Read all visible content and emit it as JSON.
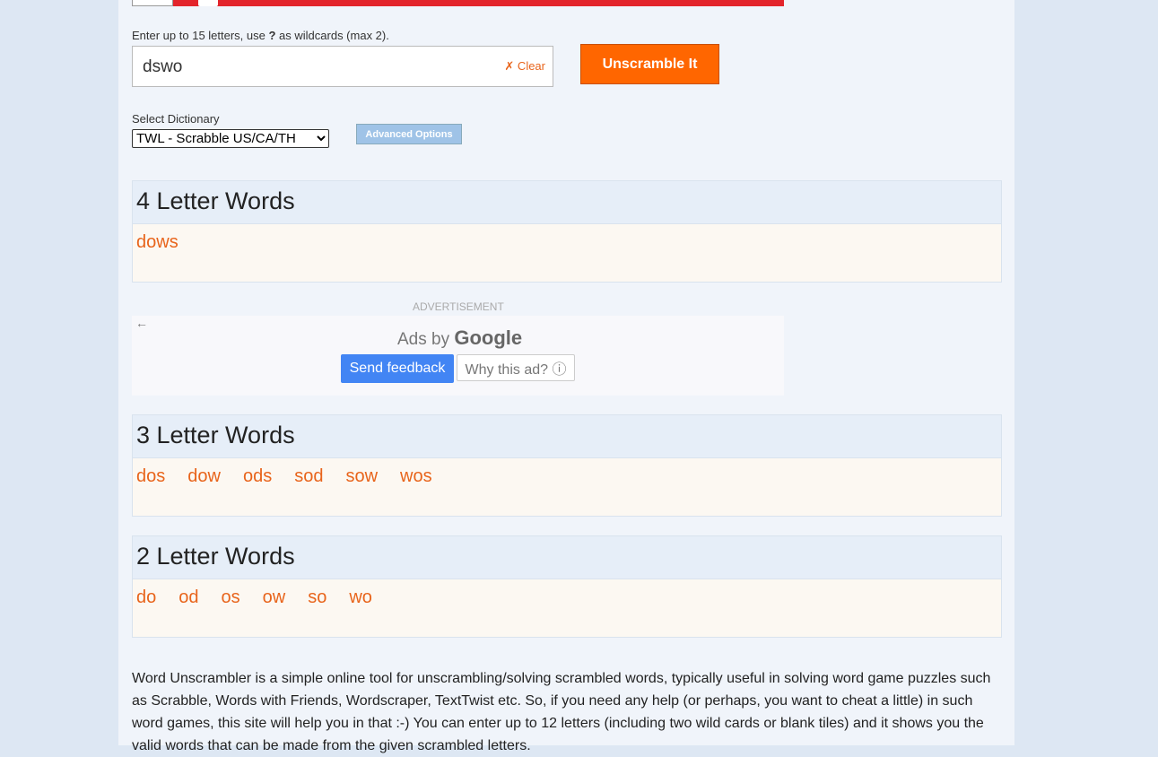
{
  "form": {
    "hint_prefix": "Enter up to 15 letters, use ",
    "hint_wildcard": "?",
    "hint_suffix": " as wildcards (max 2).",
    "letters_value": "dswo",
    "clear_label": "✗ Clear",
    "unscramble_label": "Unscramble It",
    "dictionary_label": "Select Dictionary",
    "dictionary_selected": "TWL - Scrabble US/CA/TH",
    "advanced_label": "Advanced Options"
  },
  "sections": [
    {
      "title": "4 Letter Words",
      "words": [
        "dows"
      ]
    },
    {
      "title": "3 Letter Words",
      "words": [
        "dos",
        "dow",
        "ods",
        "sod",
        "sow",
        "wos"
      ]
    },
    {
      "title": "2 Letter Words",
      "words": [
        "do",
        "od",
        "os",
        "ow",
        "so",
        "wo"
      ]
    }
  ],
  "ad": {
    "label": "ADVERTISEMENT",
    "back_icon": "←",
    "ads_by": "Ads by",
    "google": "Google",
    "send_feedback": "Send feedback",
    "why_this_ad": "Why this ad? ⓘ"
  },
  "description": "Word Unscrambler is a simple online tool for unscrambling/solving scrambled words, typically useful in solving word game puzzles such as Scrabble, Words with Friends, Wordscraper, TextTwist etc. So, if you need any help (or perhaps, you want to cheat a little) in such word games, this site will help you in that :-) You can enter up to 12 letters (including two wild cards or blank tiles) and it shows you the valid words that can be made from the given scrambled letters.",
  "colors": {
    "accent": "#ff6600",
    "word_link": "#e8641b",
    "section_header_bg": "#e6eef8",
    "section_body_bg": "#fcf8f2",
    "google_blue": "#4285f4"
  }
}
